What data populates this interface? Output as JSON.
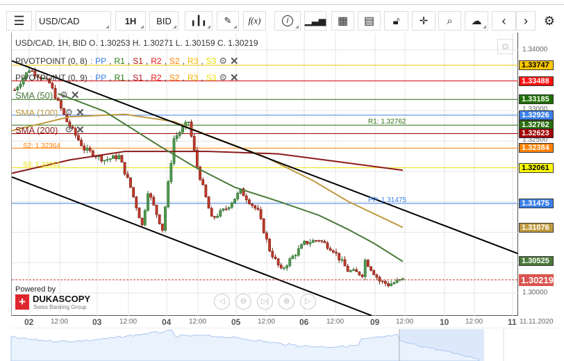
{
  "toolbar": {
    "symbol": "USD/CAD",
    "period": "1H",
    "side": "BID"
  },
  "header": {
    "ohlc": "USD/CAD, 1H, BID   O. 1.30253 H. 1.30271 L. 1.30159 C. 1.30219"
  },
  "indicators": [
    {
      "name": "PIVOTPOINT (0, 8)",
      "sep": " : "
    },
    {
      "name": "PIVOTPOINT (0, 9)",
      "sep": " : "
    }
  ],
  "pivot_keys": [
    {
      "k": "PP",
      "c": "#3a80e8"
    },
    {
      "k": "R1",
      "c": "#2a7a10"
    },
    {
      "k": "S1",
      "c": "#b01010"
    },
    {
      "k": "R2",
      "c": "#ee1010"
    },
    {
      "k": "S2",
      "c": "#ff8000"
    },
    {
      "k": "R3",
      "c": "#f0b800"
    },
    {
      "k": "S3",
      "c": "#e8e000"
    }
  ],
  "smas": [
    {
      "name": "SMA (50)",
      "color": "#4a7a3a"
    },
    {
      "name": "SMA (100)",
      "color": "#c09a40"
    },
    {
      "name": "SMA (200)",
      "color": "#8b1a1a"
    }
  ],
  "chart_labels": {
    "r1": "R1: 1.32762",
    "pp": "PP: 1.31475",
    "s2": "S2: 1.32364",
    "s3": "S3: 1.32061"
  },
  "price_axis": [
    "1.34000",
    "1.33000",
    "1.32500",
    "1.30000"
  ],
  "price_tags": [
    {
      "v": "1.33747",
      "bg": "#ffc800",
      "fg": "#000",
      "line": "#f5c400"
    },
    {
      "v": "1.33488",
      "bg": "#ff1010",
      "fg": "#fff",
      "line": "#e01010"
    },
    {
      "v": "1.33185",
      "bg": "#1e6e00",
      "fg": "#fff",
      "line": "#2a6a10"
    },
    {
      "v": "1.32926",
      "bg": "#3a80e8",
      "fg": "#fff",
      "line": "#3a80e8"
    },
    {
      "v": "1.32762",
      "bg": "#2a6e10",
      "fg": "#fff",
      "line": "#2a6e10"
    },
    {
      "v": "1.32623",
      "bg": "#a00000",
      "fg": "#fff",
      "line": "#a00000"
    },
    {
      "v": "1.32384",
      "bg": "#ff8000",
      "fg": "#fff",
      "line": "#ff8000"
    },
    {
      "v": "1.32061",
      "bg": "#ffff00",
      "fg": "#000",
      "line": "#f0e000"
    },
    {
      "v": "1.31475",
      "bg": "#3a80e8",
      "fg": "#fff",
      "line": "#3a80e8"
    },
    {
      "v": "1.31076",
      "bg": "#c09a40",
      "fg": "#fff",
      "line": null
    },
    {
      "v": "1.30525",
      "bg": "#4a7a3a",
      "fg": "#fff",
      "line": null
    }
  ],
  "last_price": {
    "v": "1.30219",
    "bg": "#d9534f"
  },
  "time_axis": [
    {
      "t": "02",
      "d": true
    },
    {
      "t": "12:00"
    },
    {
      "t": "03",
      "d": true
    },
    {
      "t": "12:00"
    },
    {
      "t": "04",
      "d": true
    },
    {
      "t": "12:00"
    },
    {
      "t": "05",
      "d": true
    },
    {
      "t": "12:00"
    },
    {
      "t": "06",
      "d": true
    },
    {
      "t": "12:00"
    },
    {
      "t": "09",
      "d": true
    },
    {
      "t": "12:00"
    },
    {
      "t": "10",
      "d": true
    },
    {
      "t": "12:00"
    },
    {
      "t": "11",
      "d": true
    }
  ],
  "date_label": "11.11.2020",
  "branding": {
    "powered": "Powered by",
    "name": "DUKASCOPY",
    "sub": "Swiss Banking Group"
  },
  "chart_data": {
    "type": "candlestick",
    "price_path": [
      [
        -5,
        1.3334
      ],
      [
        0,
        1.3368
      ],
      [
        7,
        1.3345
      ],
      [
        13,
        1.3282
      ],
      [
        19,
        1.3237
      ],
      [
        26,
        1.3219
      ],
      [
        31,
        1.3225
      ],
      [
        35,
        1.3174
      ],
      [
        39,
        1.3111
      ],
      [
        41,
        1.3168
      ],
      [
        46,
        1.3105
      ],
      [
        50,
        1.3254
      ],
      [
        55,
        1.3282
      ],
      [
        58,
        1.3208
      ],
      [
        63,
        1.3122
      ],
      [
        68,
        1.3139
      ],
      [
        73,
        1.3168
      ],
      [
        79,
        1.3134
      ],
      [
        83,
        1.3071
      ],
      [
        87,
        1.3037
      ],
      [
        91,
        1.306
      ],
      [
        95,
        1.3082
      ],
      [
        100,
        1.3088
      ],
      [
        105,
        1.3071
      ],
      [
        110,
        1.3037
      ],
      [
        115,
        1.3031
      ],
      [
        116,
        1.3054
      ],
      [
        121,
        1.302
      ],
      [
        124,
        1.3014
      ],
      [
        129,
        1.3022
      ]
    ],
    "sma50": [
      [
        10,
        1.3328
      ],
      [
        26,
        1.3299
      ],
      [
        45,
        1.3242
      ],
      [
        57,
        1.3208
      ],
      [
        71,
        1.3174
      ],
      [
        86,
        1.3151
      ],
      [
        100,
        1.3128
      ],
      [
        110,
        1.3105
      ],
      [
        119,
        1.3082
      ],
      [
        129,
        1.3052
      ]
    ],
    "sma100": [
      [
        -6,
        1.3267
      ],
      [
        14,
        1.329
      ],
      [
        33,
        1.3294
      ],
      [
        50,
        1.3282
      ],
      [
        62,
        1.3259
      ],
      [
        81,
        1.3225
      ],
      [
        98,
        1.3185
      ],
      [
        110,
        1.3151
      ],
      [
        129,
        1.3108
      ]
    ],
    "sma200": [
      [
        -6,
        1.3197
      ],
      [
        14,
        1.3219
      ],
      [
        33,
        1.3233
      ],
      [
        62,
        1.3233
      ],
      [
        86,
        1.3229
      ],
      [
        110,
        1.3214
      ],
      [
        129,
        1.3202
      ]
    ],
    "channel_upper": [
      [
        -6,
        1.3382
      ],
      [
        168.7,
        1.3065
      ]
    ],
    "channel_lower": [
      [
        -6,
        1.3191
      ],
      [
        118.2,
        1.2963
      ]
    ]
  }
}
